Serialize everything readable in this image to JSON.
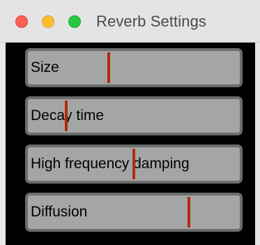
{
  "window": {
    "title": "Reverb Settings",
    "traffic_lights": {
      "close": {
        "icon": "close-button",
        "color": "#fe5f57",
        "border": "#e0443e"
      },
      "minimize": {
        "icon": "minimize-button",
        "color": "#febc2e",
        "border": "#dea123"
      },
      "zoom": {
        "icon": "zoom-button",
        "color": "#28c840",
        "border": "#1aab29"
      }
    }
  },
  "sliders": [
    {
      "id": "size",
      "label": "Size",
      "value": 0.38
    },
    {
      "id": "decay-time",
      "label": "Decay time",
      "value": 0.18
    },
    {
      "id": "high-frequency-damping",
      "label": "High frequency damping",
      "value": 0.5
    },
    {
      "id": "diffusion",
      "label": "Diffusion",
      "value": 0.76
    }
  ],
  "colors": {
    "thumb": "#b22b0c",
    "track": "#a4a6a6",
    "track_border": "#6b6d6d",
    "panel_background": "#000000"
  }
}
